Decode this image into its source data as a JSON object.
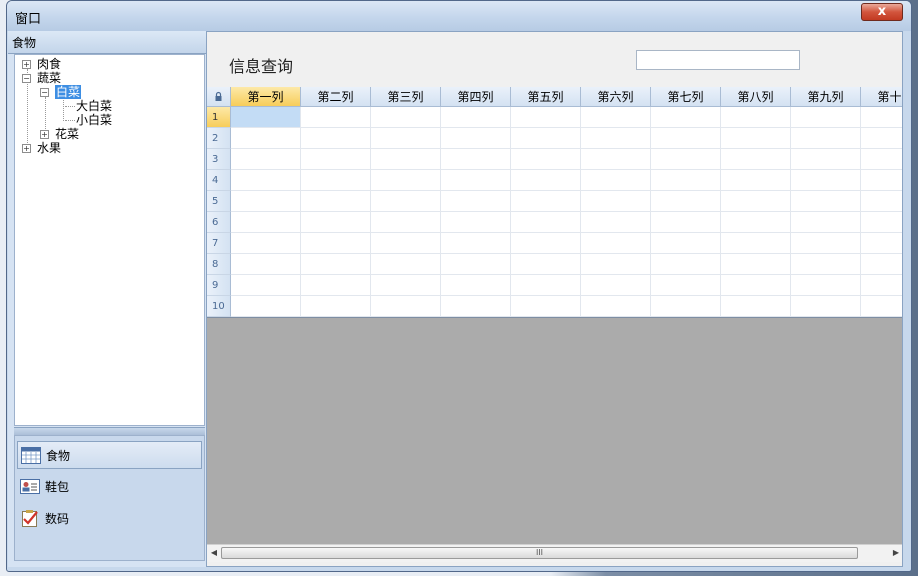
{
  "window": {
    "title": "窗口",
    "close_label": "x"
  },
  "tree": {
    "header": "食物",
    "nodes": [
      {
        "label": "肉食",
        "expander": "+"
      },
      {
        "label": "蔬菜",
        "expander": "−"
      },
      {
        "label": "白菜",
        "expander": "−"
      },
      {
        "label": "大白菜"
      },
      {
        "label": "小白菜"
      },
      {
        "label": "花菜",
        "expander": "+"
      },
      {
        "label": "水果",
        "expander": "+"
      }
    ]
  },
  "nav": {
    "items": [
      {
        "label": "食物",
        "icon": "calendar-grid-icon",
        "active": true
      },
      {
        "label": "鞋包",
        "icon": "contact-card-icon"
      },
      {
        "label": "数码",
        "icon": "checklist-icon"
      }
    ]
  },
  "query": {
    "label": "信息查询",
    "input_value": ""
  },
  "grid": {
    "columns": [
      "第一列",
      "第二列",
      "第三列",
      "第四列",
      "第五列",
      "第六列",
      "第七列",
      "第八列",
      "第九列",
      "第十列"
    ],
    "rows": [
      "1",
      "2",
      "3",
      "4",
      "5",
      "6",
      "7",
      "8",
      "9",
      "10"
    ],
    "corner_icon": "lock-icon"
  },
  "scrollbar": {
    "left_arrow": "◀",
    "right_arrow": "▶",
    "grip": "III"
  }
}
